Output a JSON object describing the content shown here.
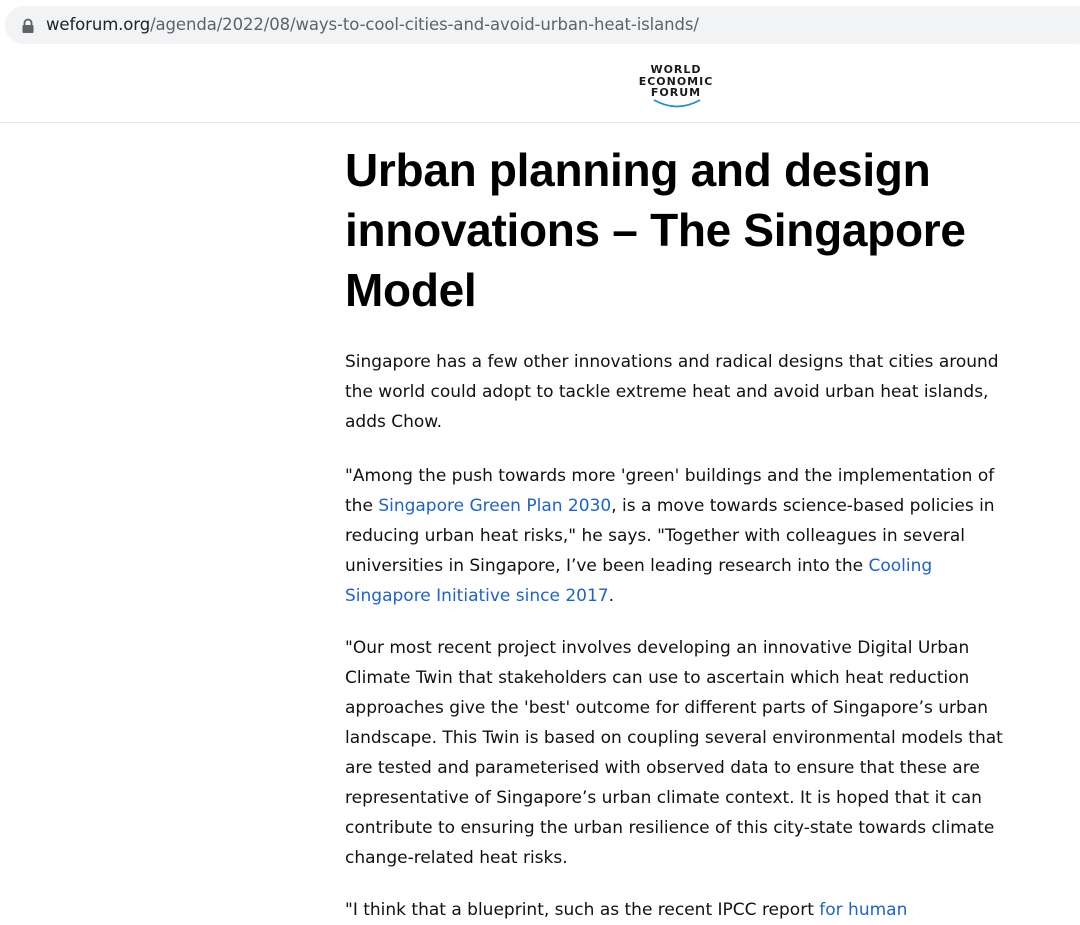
{
  "browser": {
    "url_host": "weforum.org",
    "url_path": "/agenda/2022/08/ways-to-cool-cities-and-avoid-urban-heat-islands/",
    "lock_icon": "lock-icon"
  },
  "header": {
    "logo_lines": [
      "WORLD",
      "ECONOMIC",
      "FORUM"
    ]
  },
  "article": {
    "title": "Urban planning and design innovations – The Singapore Model",
    "p1": "Singapore has a few other innovations and radical designs that cities around the world could adopt to tackle extreme heat and avoid urban heat islands, adds Chow.",
    "p2": {
      "before": "\"Among the push towards more 'green' buildings and the implementation of the ",
      "link1": "Singapore Green Plan 2030",
      "middle": ", is a move towards science-based policies in reducing urban heat risks,\" he says. \"Together with colleagues in several universities in Singapore, I’ve been leading research into the ",
      "link2": "Cooling Singapore Initiative since 2017",
      "after": "."
    },
    "p3": "\"Our most recent project involves developing an innovative Digital Urban Climate Twin that stakeholders can use to ascertain which heat reduction approaches give the 'best' outcome for different parts of Singapore’s urban landscape. This Twin is based on coupling several environmental models that are tested and parameterised with observed data to ensure that these are representative of Singapore’s urban climate context. It is hoped that it can contribute to ensuring the urban resilience of this city-state towards climate change-related heat risks.",
    "p4": {
      "before": "\"I think that a blueprint, such as the recent IPCC report ",
      "link": "for human"
    }
  },
  "colors": {
    "link": "#1e63c9",
    "address_bar": "#f1f3f4",
    "logo_arc": "#1e8fd6"
  }
}
